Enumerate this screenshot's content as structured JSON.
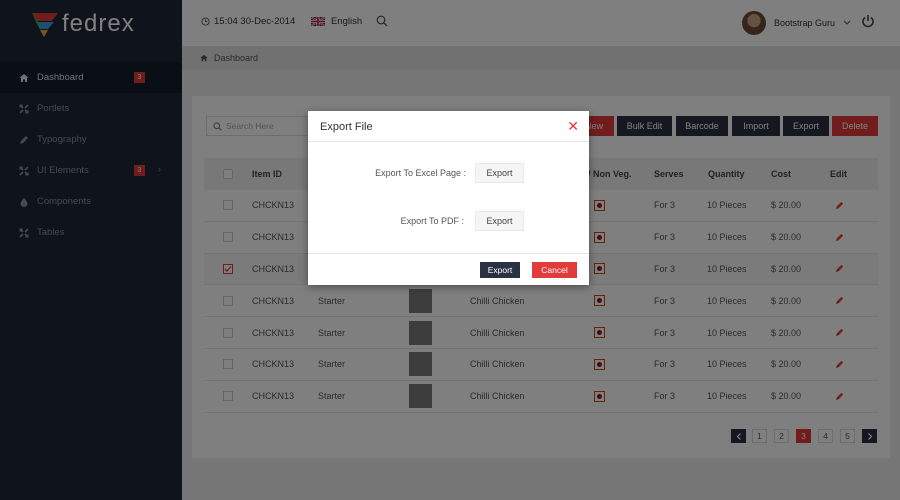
{
  "app": {
    "name": "fedrex"
  },
  "colors": {
    "accent": "#e23b3b",
    "sidebar": "#1d2738",
    "dark_button": "#2a3142"
  },
  "header": {
    "datetime": "15:04 30-Dec-2014",
    "language": "English",
    "user_name": "Bootstrap Guru"
  },
  "breadcrumb": {
    "current": "Dashboard"
  },
  "sidebar": {
    "items": [
      {
        "label": "Dashboard",
        "icon": "home-icon",
        "badge": "3"
      },
      {
        "label": "Portlets",
        "icon": "expand-icon"
      },
      {
        "label": "Typography",
        "icon": "pencil-icon"
      },
      {
        "label": "UI Elements",
        "icon": "expand-icon",
        "badge": "3"
      },
      {
        "label": "Components",
        "icon": "drop-icon"
      },
      {
        "label": "Tables",
        "icon": "expand-icon"
      }
    ]
  },
  "toolbar": {
    "search_placeholder": "Search Here",
    "new_label": "New",
    "bulk_edit_label": "Bulk Edit",
    "barcode_label": "Barcode",
    "import_label": "Import",
    "export_label": "Export",
    "delete_label": "Delete"
  },
  "table": {
    "headers": {
      "item_id": "Item ID",
      "veg": "/ Non Veg.",
      "serves": "Serves",
      "quantity": "Quantity",
      "cost": "Cost",
      "edit": "Edit"
    },
    "rows": [
      {
        "id": "CHCKN13",
        "category": "",
        "name": "",
        "serves": "For 3",
        "quantity": "10 Pieces",
        "cost": "$ 20.00",
        "checked": false,
        "thumb": false
      },
      {
        "id": "CHCKN13",
        "category": "",
        "name": "",
        "serves": "For 3",
        "quantity": "10 Pieces",
        "cost": "$ 20.00",
        "checked": false,
        "thumb": false
      },
      {
        "id": "CHCKN13",
        "category": "",
        "name": "",
        "serves": "For 3",
        "quantity": "10 Pieces",
        "cost": "$ 20.00",
        "checked": true,
        "thumb": false
      },
      {
        "id": "CHCKN13",
        "category": "Starter",
        "name": "Chilli Chicken",
        "serves": "For 3",
        "quantity": "10 Pieces",
        "cost": "$ 20.00",
        "checked": false,
        "thumb": true
      },
      {
        "id": "CHCKN13",
        "category": "Starter",
        "name": "Chilli Chicken",
        "serves": "For 3",
        "quantity": "10 Pieces",
        "cost": "$ 20.00",
        "checked": false,
        "thumb": true
      },
      {
        "id": "CHCKN13",
        "category": "Starter",
        "name": "Chilli Chicken",
        "serves": "For 3",
        "quantity": "10 Pieces",
        "cost": "$ 20.00",
        "checked": false,
        "thumb": true
      },
      {
        "id": "CHCKN13",
        "category": "Starter",
        "name": "Chilli Chicken",
        "serves": "For 3",
        "quantity": "10 Pieces",
        "cost": "$ 20.00",
        "checked": false,
        "thumb": true
      }
    ]
  },
  "pagination": {
    "pages": [
      "1",
      "2",
      "3",
      "4",
      "5"
    ],
    "current": "3"
  },
  "modal": {
    "title": "Export File",
    "excel_label": "Export To Excel Page :",
    "excel_button": "Export",
    "pdf_label": "Export To PDF :",
    "pdf_button": "Export",
    "export_button": "Export",
    "cancel_button": "Cancel"
  }
}
